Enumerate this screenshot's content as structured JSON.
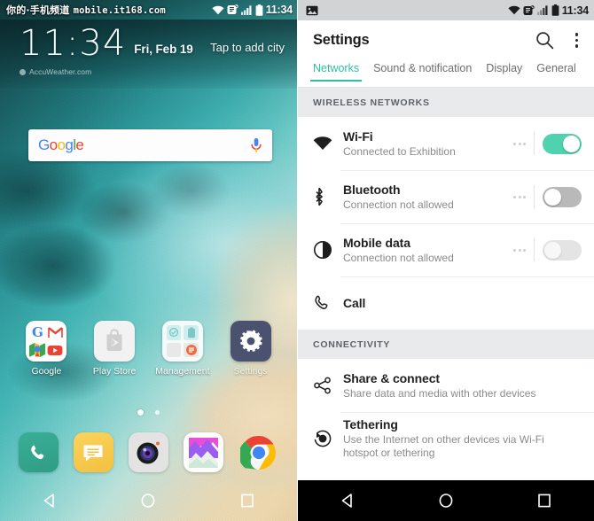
{
  "home": {
    "statusbar": {
      "watermark": "你的·手机频道",
      "watermark_url": "mobile.it168.com",
      "time": "11:34",
      "icons": [
        "wifi-icon",
        "vibrate-icon",
        "signal-icon",
        "battery-icon"
      ]
    },
    "clock_widget": {
      "time": "11:34",
      "date": "Fri, Feb 19",
      "city_hint": "Tap to add city",
      "attribution": "AccuWeather.com"
    },
    "search": {
      "logo_letters": [
        "G",
        "o",
        "o",
        "g",
        "l",
        "e"
      ],
      "mic_icon": "microphone-icon"
    },
    "apps": [
      {
        "label": "Google",
        "type": "folder-google"
      },
      {
        "label": "Play Store",
        "type": "play-store"
      },
      {
        "label": "Management",
        "type": "folder-management"
      },
      {
        "label": "Settings",
        "type": "settings"
      }
    ],
    "page_dots": {
      "count": 2,
      "active_index": 0
    },
    "dock": [
      {
        "name": "phone",
        "icon": "phone-icon"
      },
      {
        "name": "messages",
        "icon": "message-icon"
      },
      {
        "name": "camera",
        "icon": "camera-icon"
      },
      {
        "name": "gallery",
        "icon": "gallery-icon"
      },
      {
        "name": "chrome",
        "icon": "chrome-icon"
      }
    ],
    "navbar": [
      {
        "name": "back",
        "icon": "triangle-back-icon"
      },
      {
        "name": "home",
        "icon": "circle-home-icon"
      },
      {
        "name": "recents",
        "icon": "square-recents-icon"
      }
    ]
  },
  "settings": {
    "statusbar": {
      "time": "11:34",
      "left_icon": "screenshot-image-icon",
      "icons": [
        "wifi-icon",
        "vibrate-icon",
        "signal-icon",
        "battery-icon"
      ]
    },
    "appbar": {
      "title": "Settings",
      "search_icon": "search-icon",
      "overflow_icon": "kebab-menu-icon"
    },
    "tabs": [
      {
        "label": "Networks",
        "active": true
      },
      {
        "label": "Sound & notification",
        "active": false
      },
      {
        "label": "Display",
        "active": false
      },
      {
        "label": "General",
        "active": false
      }
    ],
    "sections": [
      {
        "header": "WIRELESS NETWORKS",
        "rows": [
          {
            "title": "Wi-Fi",
            "subtitle": "Connected to Exhibition",
            "icon": "wifi-icon",
            "has_overflow": true,
            "toggle": "on"
          },
          {
            "title": "Bluetooth",
            "subtitle": "Connection not allowed",
            "icon": "bluetooth-icon",
            "has_overflow": true,
            "toggle": "off"
          },
          {
            "title": "Mobile data",
            "subtitle": "Connection not allowed",
            "icon": "mobile-data-icon",
            "has_overflow": true,
            "toggle": "disabled"
          },
          {
            "title": "Call",
            "subtitle": "",
            "icon": "call-icon",
            "has_overflow": false,
            "toggle": "none"
          }
        ]
      },
      {
        "header": "CONNECTIVITY",
        "rows": [
          {
            "title": "Share & connect",
            "subtitle": "Share data and media with other devices",
            "icon": "share-icon",
            "has_overflow": false,
            "toggle": "none"
          },
          {
            "title": "Tethering",
            "subtitle": "Use the Internet on other devices via Wi-Fi hotspot or tethering",
            "icon": "tethering-icon",
            "has_overflow": false,
            "toggle": "none"
          }
        ]
      }
    ],
    "navbar": [
      {
        "name": "back",
        "icon": "triangle-back-icon"
      },
      {
        "name": "home",
        "icon": "circle-home-icon"
      },
      {
        "name": "recents",
        "icon": "square-recents-icon"
      }
    ]
  },
  "colors": {
    "accent_teal": "#30bfa0",
    "toggle_on": "#4fd3ae",
    "toggle_off": "#b9b9b9",
    "section_header_bg": "#e8eaec",
    "statusbar_bg": "#d2d3d5"
  }
}
